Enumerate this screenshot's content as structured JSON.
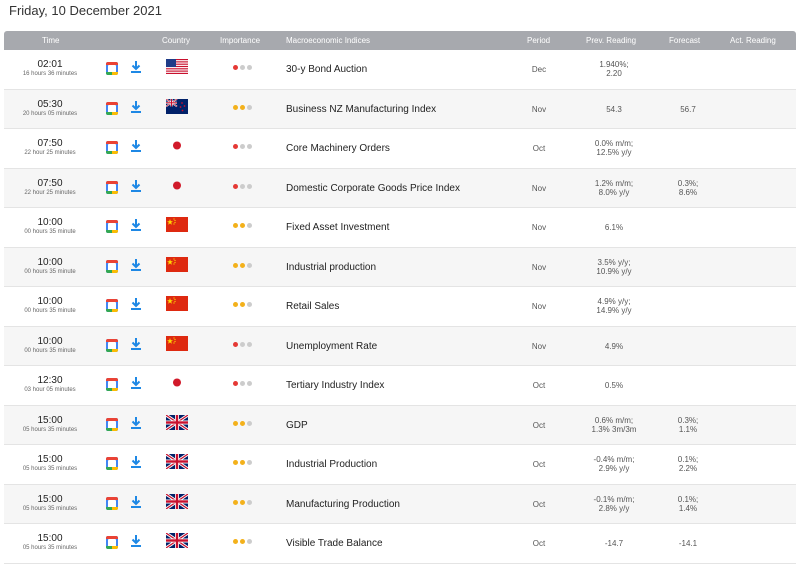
{
  "page": {
    "date_title": "Friday, 10 December 2021"
  },
  "columns": {
    "time": "Time",
    "country": "Country",
    "importance": "Importance",
    "indicator": "Macroeconomic Indices",
    "period": "Period",
    "prev": "Prev. Reading",
    "forecast": "Forecast",
    "actual": "Act. Reading"
  },
  "colors": {
    "header_bg": "#a7a9ae",
    "importance_red": "#e53935",
    "importance_yellow": "#f3b11b",
    "importance_off": "#cccccc"
  },
  "icons": {
    "calendar": "google-calendar-icon",
    "download": "download-icon"
  },
  "rows": [
    {
      "time": "02:01",
      "countdown": "16 hours 36 minutes",
      "country": "US",
      "importance": 1,
      "indicator": "30-y Bond Auction",
      "period": "Dec",
      "prev": [
        "1.940%;",
        "2.20"
      ],
      "forecast": [],
      "actual": ""
    },
    {
      "time": "05:30",
      "countdown": "20 hours 05 minutes",
      "country": "NZ",
      "importance": 2,
      "indicator": "Business NZ Manufacturing Index",
      "period": "Nov",
      "prev": [
        "54.3"
      ],
      "forecast": [
        "56.7"
      ],
      "actual": ""
    },
    {
      "time": "07:50",
      "countdown": "22 hour 25 minutes",
      "country": "JP",
      "importance": 1,
      "indicator": "Core Machinery Orders",
      "period": "Oct",
      "prev": [
        "0.0% m/m;",
        "12.5% y/y"
      ],
      "forecast": [],
      "actual": ""
    },
    {
      "time": "07:50",
      "countdown": "22 hour 25 minutes",
      "country": "JP",
      "importance": 1,
      "indicator": "Domestic Corporate Goods Price Index",
      "period": "Nov",
      "prev": [
        "1.2% m/m;",
        "8.0% y/y"
      ],
      "forecast": [
        "0.3%;",
        "8.6%"
      ],
      "actual": ""
    },
    {
      "time": "10:00",
      "countdown": "00 hours 35 minute",
      "country": "CN",
      "importance": 2,
      "indicator": "Fixed Asset Investment",
      "period": "Nov",
      "prev": [
        "6.1%"
      ],
      "forecast": [],
      "actual": ""
    },
    {
      "time": "10:00",
      "countdown": "00 hours 35 minute",
      "country": "CN",
      "importance": 2,
      "indicator": "Industrial production",
      "period": "Nov",
      "prev": [
        "3.5% y/y;",
        "10.9% y/y"
      ],
      "forecast": [],
      "actual": ""
    },
    {
      "time": "10:00",
      "countdown": "00 hours 35 minute",
      "country": "CN",
      "importance": 2,
      "indicator": "Retail Sales",
      "period": "Nov",
      "prev": [
        "4.9% y/y;",
        "14.9% y/y"
      ],
      "forecast": [],
      "actual": ""
    },
    {
      "time": "10:00",
      "countdown": "00 hours 35 minute",
      "country": "CN",
      "importance": 1,
      "indicator": "Unemployment Rate",
      "period": "Nov",
      "prev": [
        "4.9%"
      ],
      "forecast": [],
      "actual": ""
    },
    {
      "time": "12:30",
      "countdown": "03 hour 05 minutes",
      "country": "JP",
      "importance": 1,
      "indicator": "Tertiary Industry Index",
      "period": "Oct",
      "prev": [
        "0.5%"
      ],
      "forecast": [],
      "actual": ""
    },
    {
      "time": "15:00",
      "countdown": "05 hours 35 minutes",
      "country": "GB",
      "importance": 2,
      "indicator": "GDP",
      "period": "Oct",
      "prev": [
        "0.6% m/m;",
        "1.3% 3m/3m"
      ],
      "forecast": [
        "0.3%;",
        "1.1%"
      ],
      "actual": ""
    },
    {
      "time": "15:00",
      "countdown": "05 hours 35 minutes",
      "country": "GB",
      "importance": 2,
      "indicator": "Industrial Production",
      "period": "Oct",
      "prev": [
        "-0.4% m/m;",
        "2.9% y/y"
      ],
      "forecast": [
        "0.1%;",
        "2.2%"
      ],
      "actual": ""
    },
    {
      "time": "15:00",
      "countdown": "05 hours 35 minutes",
      "country": "GB",
      "importance": 2,
      "indicator": "Manufacturing Production",
      "period": "Oct",
      "prev": [
        "-0.1% m/m;",
        "2.8% y/y"
      ],
      "forecast": [
        "0.1%;",
        "1.4%"
      ],
      "actual": ""
    },
    {
      "time": "15:00",
      "countdown": "05 hours 35 minutes",
      "country": "GB",
      "importance": 2,
      "indicator": "Visible Trade Balance",
      "period": "Oct",
      "prev": [
        "-14.7"
      ],
      "forecast": [
        "-14.1"
      ],
      "actual": ""
    }
  ]
}
